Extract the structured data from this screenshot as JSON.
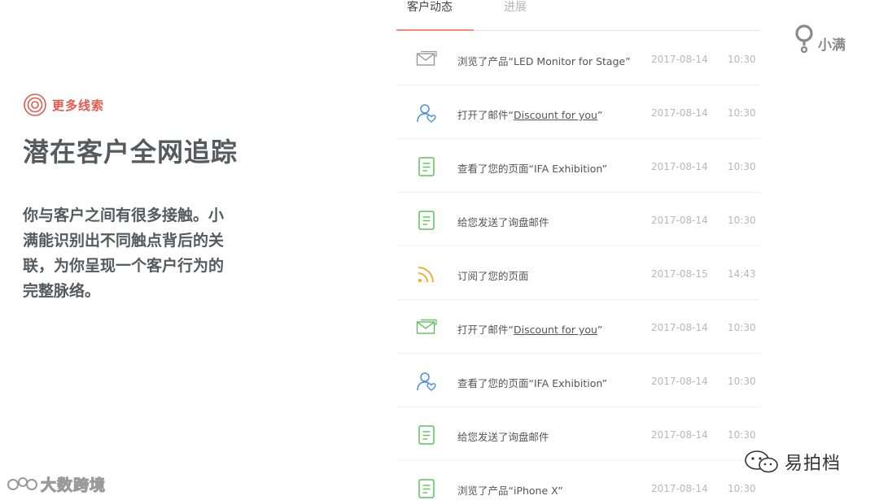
{
  "feature": {
    "tag": "更多线索",
    "headline": "潜在客户全网追踪",
    "description": "你与客户之间有很多接触。小满能识别出不同触点背后的关联，为你呈现一个客户行为的完整脉络。"
  },
  "feed": {
    "tabs": [
      {
        "label": "客户动态",
        "active": true
      },
      {
        "label": "进展",
        "active": false
      }
    ],
    "items": [
      {
        "icon": "envelope-icon",
        "color": "#9a9a9a",
        "prefix": "浏览了产品“LED Monitor for Stage”",
        "link": "",
        "suffix": "",
        "date": "2017-08-14",
        "time": "10:30"
      },
      {
        "icon": "user-heart-icon",
        "color": "#4a90d9",
        "prefix": "打开了邮件“",
        "link": "Discount for you",
        "suffix": "”",
        "date": "2017-08-14",
        "time": "10:30"
      },
      {
        "icon": "document-icon",
        "color": "#5cc15c",
        "prefix": "查看了您的页面“IFA Exhibition”",
        "link": "",
        "suffix": "",
        "date": "2017-08-14",
        "time": "10:30"
      },
      {
        "icon": "document-icon",
        "color": "#5cc15c",
        "prefix": "给您发送了询盘邮件",
        "link": "",
        "suffix": "",
        "date": "2017-08-14",
        "time": "10:30"
      },
      {
        "icon": "rss-icon",
        "color": "#f5a623",
        "prefix": "订阅了您的页面",
        "link": "",
        "suffix": "",
        "date": "2017-08-15",
        "time": "14:43"
      },
      {
        "icon": "envelope-icon",
        "color": "#5cc15c",
        "prefix": "打开了邮件“",
        "link": "Discount for you",
        "suffix": "”",
        "date": "2017-08-14",
        "time": "10:30"
      },
      {
        "icon": "user-heart-icon",
        "color": "#4a90d9",
        "prefix": "查看了您的页面“IFA Exhibition”",
        "link": "",
        "suffix": "",
        "date": "2017-08-14",
        "time": "10:30"
      },
      {
        "icon": "document-icon",
        "color": "#5cc15c",
        "prefix": "给您发送了询盘邮件",
        "link": "",
        "suffix": "",
        "date": "2017-08-14",
        "time": "10:30"
      },
      {
        "icon": "document-icon",
        "color": "#5cc15c",
        "prefix": "浏览了产品“iPhone X”",
        "link": "",
        "suffix": "",
        "date": "2017-08-14",
        "time": "10:30"
      }
    ]
  },
  "brand": {
    "name": "小满"
  },
  "watermarks": {
    "left": "大数跨境",
    "right": "易拍档"
  },
  "colors": {
    "accent": "#e05a4e",
    "tab_underline": "#f08b7e",
    "green": "#5cc15c",
    "blue": "#4a90d9",
    "orange": "#f5a623",
    "gray": "#9a9a9a"
  }
}
